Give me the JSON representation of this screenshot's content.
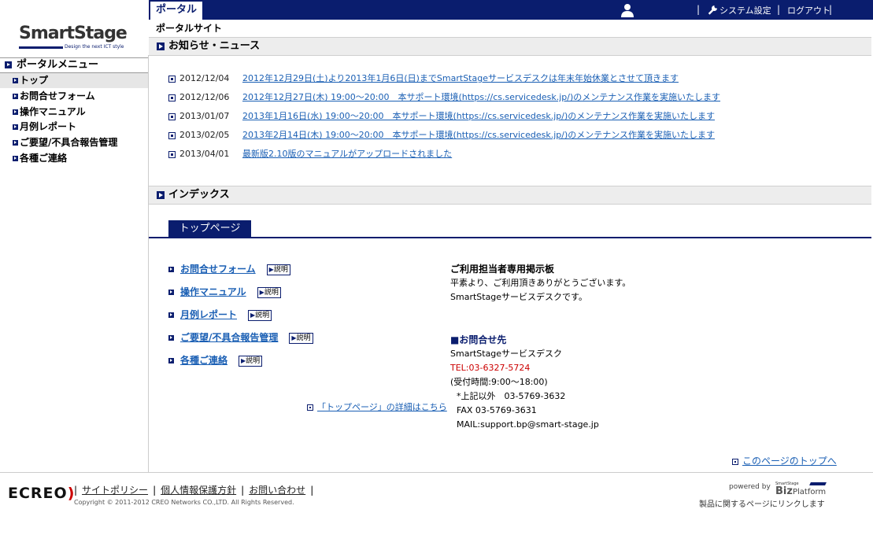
{
  "header": {
    "tab_portal": "ポータル",
    "links": [
      "システム設定",
      "ログアウト"
    ],
    "separator": "|"
  },
  "logo": {
    "name": "SmartStage",
    "tagline": "Design the next ICT style"
  },
  "sidebar": {
    "title": "ポータルメニュー",
    "items": [
      {
        "label": "トップ",
        "active": true
      },
      {
        "label": "お問合せフォーム"
      },
      {
        "label": "操作マニュアル"
      },
      {
        "label": "月例レポート"
      },
      {
        "label": "ご要望/不具合報告管理"
      },
      {
        "label": "各種ご連絡"
      }
    ]
  },
  "main": {
    "breadcrumb": "ポータルサイト",
    "news_heading": "お知らせ・ニュース",
    "news": [
      {
        "date": "2012/12/04",
        "text": "2012年12月29日(土)より2013年1月6日(日)までSmartStageサービスデスクは年末年始休業とさせて頂きます"
      },
      {
        "date": "2012/12/06",
        "text": "2012年12月27日(木) 19:00～20:00　本サポート環境(https://cs.servicedesk.jp/)のメンテナンス作業を実施いたします"
      },
      {
        "date": "2013/01/07",
        "text": "2013年1月16日(水) 19:00～20:00　本サポート環境(https://cs.servicedesk.jp/)のメンテナンス作業を実施いたします"
      },
      {
        "date": "2013/02/05",
        "text": "2013年2月14日(木) 19:00～20:00　本サポート環境(https://cs.servicedesk.jp/)のメンテナンス作業を実施いたします"
      },
      {
        "date": "2013/04/01",
        "text": "最新版2.10版のマニュアルがアップロードされました"
      }
    ],
    "index_heading": "インデックス",
    "top_tab": "トップページ",
    "index_items": [
      {
        "label": "お問合せフォーム",
        "btn": "説明"
      },
      {
        "label": "操作マニュアル",
        "btn": "説明"
      },
      {
        "label": "月例レポート",
        "btn": "説明"
      },
      {
        "label": "ご要望/不具合報告管理",
        "btn": "説明"
      },
      {
        "label": "各種ご連絡",
        "btn": "説明"
      }
    ],
    "btn_glyph": "▶",
    "detail_link": "「トップページ」の詳細はこちら",
    "bulletin": {
      "title": "ご利用担当者専用掲示板",
      "line1": "平素より、ご利用頂きありがとうございます。",
      "line2": "SmartStageサービスデスクです。"
    },
    "contact": {
      "title": "■お問合せ先",
      "desk": "SmartStageサービスデスク",
      "tel": "TEL:03-6327-5724",
      "hours": "(受付時間:9:00～18:00)",
      "other": "*上記以外　03-5769-3632",
      "fax": "FAX 03-5769-3631",
      "mail": "MAIL:support.bp@smart-stage.jp"
    },
    "page_top": "このページのトップへ"
  },
  "footer": {
    "brand": "ecreo",
    "links": [
      "サイトポリシー",
      "個人情報保護方針",
      "お問い合わせ"
    ],
    "copyright": "Copyright © 2011-2012 CREO Networks CO.,LTD. All Rights Reserved.",
    "powered": "powered by",
    "biz_small": "SmartStage",
    "biz_big": "Biz",
    "biz_platform": "Platform",
    "note": "製品に関するページにリンクします"
  },
  "colors": {
    "navy": "#0a1d6e",
    "link": "#1a5fb4",
    "tel": "#cc0000",
    "brand_accent": "#cc0000"
  }
}
